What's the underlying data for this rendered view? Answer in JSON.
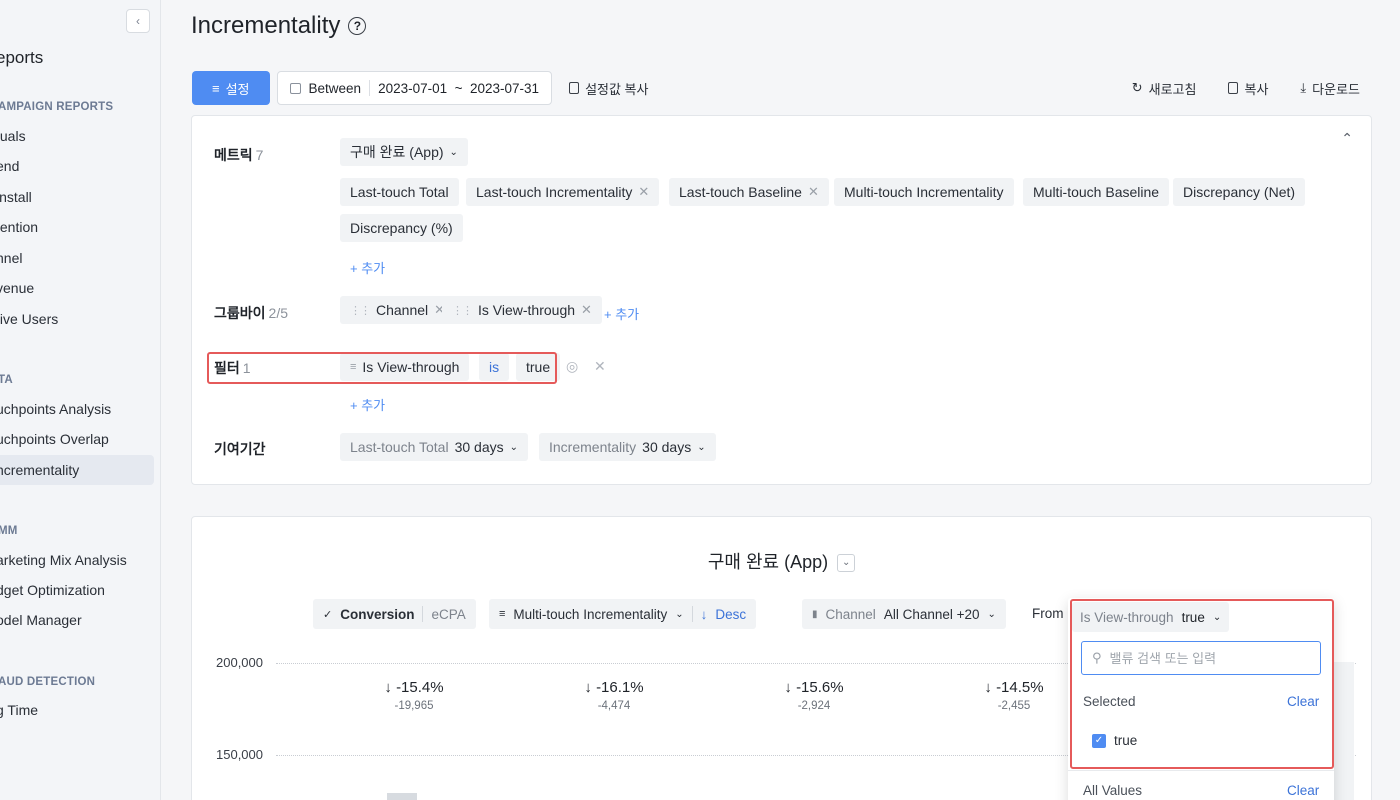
{
  "sidebar": {
    "collapse_icon": "chevron-left-icon",
    "title": "eports",
    "sections": [
      {
        "label": "AMPAIGN REPORTS",
        "items": [
          "tuals",
          "end",
          "install",
          "tention",
          "nnel",
          "venue",
          "tive Users"
        ]
      },
      {
        "label": "TA",
        "items": [
          "uchpoints Analysis",
          "uchpoints Overlap",
          "ncrementality"
        ]
      },
      {
        "label": "MM",
        "items": [
          "arketing Mix Analysis",
          "dget Optimization",
          "odel Manager"
        ]
      },
      {
        "label": "AUD DETECTION",
        "items": [
          "g Time"
        ]
      }
    ],
    "active_item": "ncrementality"
  },
  "page": {
    "title": "Incrementality",
    "help_icon": "help-circle-icon"
  },
  "toolbar": {
    "settings_label": "설정",
    "date_mode": "Between",
    "date_range": "2023-07-01  ~  2023-07-31",
    "copy_settings_label": "설정값 복사",
    "refresh_label": "새로고침",
    "copy_label": "복사",
    "download_label": "다운로드"
  },
  "settings": {
    "metric": {
      "label": "메트릭",
      "count": "7",
      "event": "구매 완료 (App)",
      "chips": [
        "Last-touch Total",
        "Last-touch Incrementality",
        "Last-touch Baseline",
        "Multi-touch Incrementality",
        "Multi-touch Baseline",
        "Discrepancy (Net)",
        "Discrepancy (%)"
      ],
      "add_label": "+ 추가"
    },
    "groupby": {
      "label": "그룹바이",
      "count": "2/5",
      "chips": [
        "Channel",
        "Is View-through"
      ],
      "add_label": "+ 추가"
    },
    "filter": {
      "label": "필터",
      "count": "1",
      "field": "Is View-through",
      "operator": "is",
      "value": "true",
      "add_label": "+ 추가"
    },
    "attribution": {
      "label": "기여기간",
      "lt_name": "Last-touch Total",
      "lt_value": "30 days",
      "inc_name": "Incrementality",
      "inc_value": "30 days"
    }
  },
  "chart": {
    "title": "구매 완료 (App)",
    "controls": {
      "conversion": "Conversion",
      "ecpa": "eCPA",
      "sort_metric": "Multi-touch Incrementality",
      "sort_dir": "Desc",
      "channel_label": "Channel",
      "channel_value": "All Channel +20",
      "from_label": "From",
      "from_field": "Is View-through",
      "from_value": "true"
    },
    "y_ticks": [
      "200,000",
      "150,000"
    ],
    "deltas": [
      {
        "pct": "-15.4%",
        "abs": "-19,965"
      },
      {
        "pct": "-16.1%",
        "abs": "-4,474"
      },
      {
        "pct": "-15.6%",
        "abs": "-2,924"
      },
      {
        "pct": "-14.5%",
        "abs": "-2,455"
      }
    ]
  },
  "dropdown": {
    "field": "Is View-through",
    "value": "true",
    "search_placeholder": "밸류 검색 또는 입력",
    "selected_label": "Selected",
    "selected_clear": "Clear",
    "selected_items": [
      "true"
    ],
    "all_values_label": "All Values",
    "all_clear": "Clear"
  }
}
